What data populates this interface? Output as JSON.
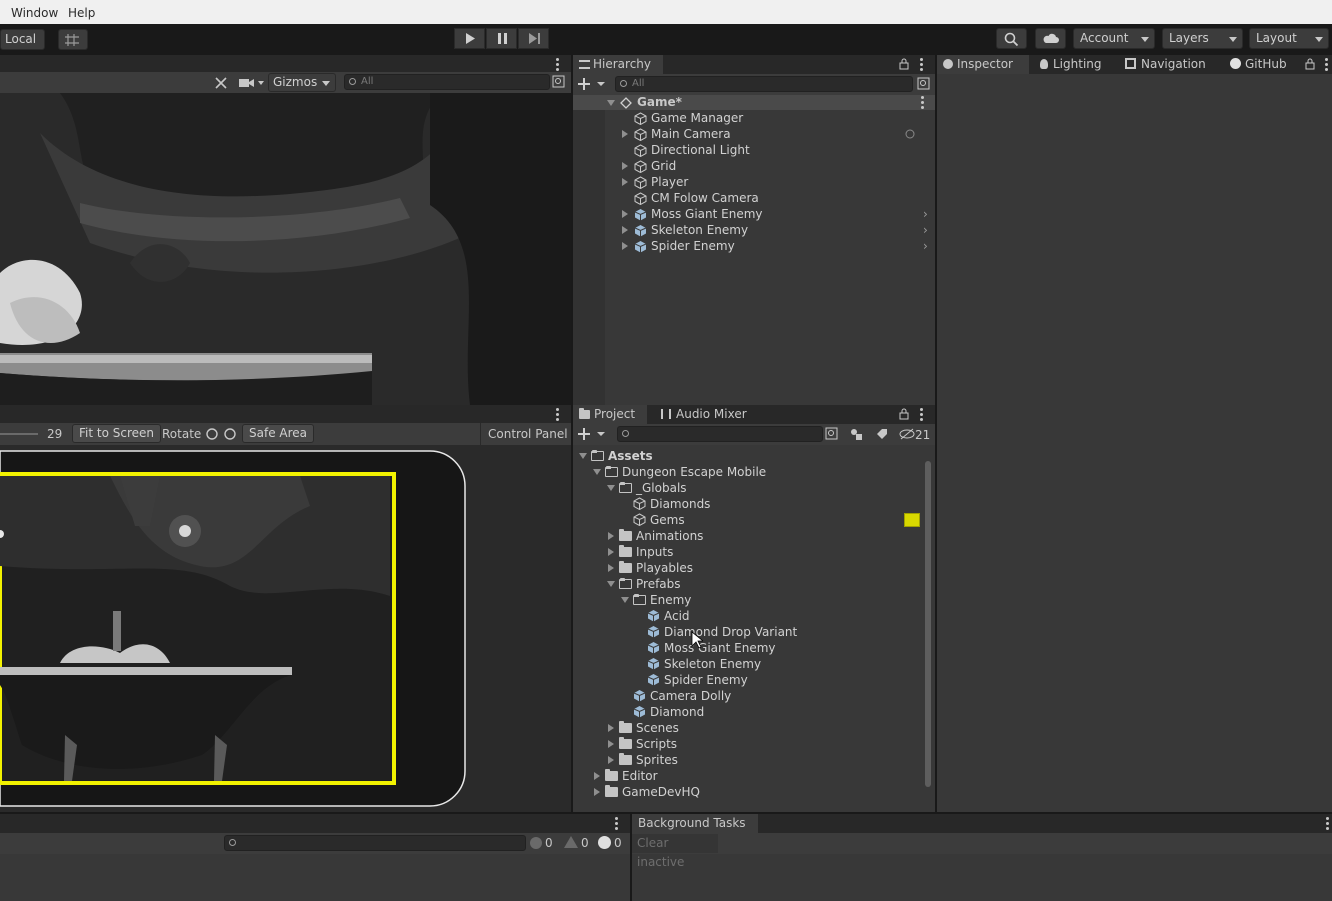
{
  "menu": [
    "Window",
    "Help"
  ],
  "toolbar": {
    "local_label": "Local",
    "account_label": "Account",
    "layers_label": "Layers",
    "layout_label": "Layout"
  },
  "scene": {
    "gizmos_label": "Gizmos",
    "search_placeholder": "All"
  },
  "game": {
    "scale_value": "29",
    "fit_label": "Fit to Screen",
    "rotate_label": "Rotate",
    "safe_area_label": "Safe Area",
    "control_panel_label": "Control Panel"
  },
  "hierarchy": {
    "tab": "Hierarchy",
    "search_placeholder": "All",
    "scene_name": "Game*",
    "items": [
      {
        "label": "Game Manager",
        "expandable": false,
        "prefab": false
      },
      {
        "label": "Main Camera",
        "expandable": true,
        "prefab": false
      },
      {
        "label": "Directional Light",
        "expandable": false,
        "prefab": false
      },
      {
        "label": "Grid",
        "expandable": true,
        "prefab": false
      },
      {
        "label": "Player",
        "expandable": true,
        "prefab": false
      },
      {
        "label": "CM Folow Camera",
        "expandable": false,
        "prefab": false
      },
      {
        "label": "Moss Giant Enemy",
        "expandable": true,
        "prefab": true
      },
      {
        "label": "Skeleton Enemy",
        "expandable": true,
        "prefab": true
      },
      {
        "label": "Spider Enemy",
        "expandable": true,
        "prefab": true
      }
    ]
  },
  "inspector_tabs": [
    "Inspector",
    "Lighting",
    "Navigation",
    "GitHub"
  ],
  "project": {
    "tabs": [
      "Project",
      "Audio Mixer"
    ],
    "hidden_count": "21",
    "tree": [
      {
        "label": "Assets",
        "depth": 0,
        "kind": "folder-open",
        "expanded": true,
        "bold": true
      },
      {
        "label": "Dungeon Escape Mobile",
        "depth": 1,
        "kind": "folder-open",
        "expanded": true
      },
      {
        "label": "_Globals",
        "depth": 2,
        "kind": "folder-open",
        "expanded": true
      },
      {
        "label": "Diamonds",
        "depth": 3,
        "kind": "asset"
      },
      {
        "label": "Gems",
        "depth": 3,
        "kind": "asset"
      },
      {
        "label": "Animations",
        "depth": 2,
        "kind": "folder",
        "expanded": false
      },
      {
        "label": "Inputs",
        "depth": 2,
        "kind": "folder",
        "expanded": false
      },
      {
        "label": "Playables",
        "depth": 2,
        "kind": "folder",
        "expanded": false
      },
      {
        "label": "Prefabs",
        "depth": 2,
        "kind": "folder-open",
        "expanded": true
      },
      {
        "label": "Enemy",
        "depth": 3,
        "kind": "folder-open",
        "expanded": true
      },
      {
        "label": "Acid",
        "depth": 4,
        "kind": "prefab"
      },
      {
        "label": "Diamond Drop Variant",
        "depth": 4,
        "kind": "prefab"
      },
      {
        "label": "Moss Giant Enemy",
        "depth": 4,
        "kind": "prefab"
      },
      {
        "label": "Skeleton Enemy",
        "depth": 4,
        "kind": "prefab"
      },
      {
        "label": "Spider Enemy",
        "depth": 4,
        "kind": "prefab"
      },
      {
        "label": "Camera Dolly",
        "depth": 3,
        "kind": "prefab"
      },
      {
        "label": "Diamond",
        "depth": 3,
        "kind": "prefab"
      },
      {
        "label": "Scenes",
        "depth": 2,
        "kind": "folder",
        "expanded": false
      },
      {
        "label": "Scripts",
        "depth": 2,
        "kind": "folder",
        "expanded": false
      },
      {
        "label": "Sprites",
        "depth": 2,
        "kind": "folder",
        "expanded": false
      },
      {
        "label": "Editor",
        "depth": 1,
        "kind": "folder",
        "expanded": false
      },
      {
        "label": "GameDevHQ",
        "depth": 1,
        "kind": "folder",
        "expanded": false
      }
    ]
  },
  "console": {
    "info_count": "0",
    "warn_count": "0",
    "error_count": "0"
  },
  "background_tasks": {
    "tab": "Background Tasks",
    "clear_label": "Clear inactive"
  },
  "colors": {
    "accent_yellow": "#f2f200",
    "panel_bg": "#383838",
    "tab_bg": "#282828"
  }
}
